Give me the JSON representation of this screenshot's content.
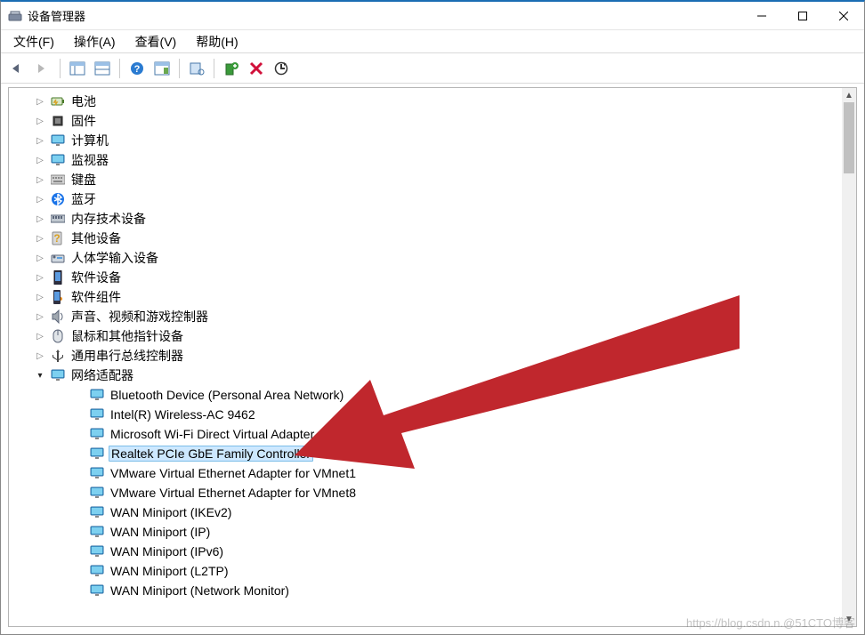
{
  "window": {
    "title": "设备管理器"
  },
  "menu": {
    "file": "文件(F)",
    "action": "操作(A)",
    "view": "查看(V)",
    "help": "帮助(H)"
  },
  "toolbar": {
    "back": "back",
    "forward": "forward",
    "grid1": "view-panel",
    "grid2": "view-list",
    "help": "help",
    "grid3": "view-details",
    "scan1": "scan-hardware",
    "scan2": "add-hardware",
    "delete": "uninstall",
    "refresh": "refresh"
  },
  "tree": {
    "top": [
      {
        "label": "电池",
        "icon": "battery"
      },
      {
        "label": "固件",
        "icon": "chip"
      },
      {
        "label": "计算机",
        "icon": "monitor"
      },
      {
        "label": "监视器",
        "icon": "monitor"
      },
      {
        "label": "键盘",
        "icon": "keyboard"
      },
      {
        "label": "蓝牙",
        "icon": "bluetooth"
      },
      {
        "label": "内存技术设备",
        "icon": "memory"
      },
      {
        "label": "其他设备",
        "icon": "question"
      },
      {
        "label": "人体学输入设备",
        "icon": "hid"
      },
      {
        "label": "软件设备",
        "icon": "phone"
      },
      {
        "label": "软件组件",
        "icon": "puzzle"
      },
      {
        "label": "声音、视频和游戏控制器",
        "icon": "speaker"
      },
      {
        "label": "鼠标和其他指针设备",
        "icon": "mouse"
      },
      {
        "label": "通用串行总线控制器",
        "icon": "usb"
      }
    ],
    "network": {
      "label": "网络适配器",
      "icon": "monitor",
      "children": [
        {
          "label": "Bluetooth Device (Personal Area Network)"
        },
        {
          "label": "Intel(R) Wireless-AC 9462"
        },
        {
          "label": "Microsoft Wi-Fi Direct Virtual Adapter"
        },
        {
          "label": "Realtek PCIe GbE Family Controller",
          "selected": true
        },
        {
          "label": "VMware Virtual Ethernet Adapter for VMnet1"
        },
        {
          "label": "VMware Virtual Ethernet Adapter for VMnet8"
        },
        {
          "label": "WAN Miniport (IKEv2)"
        },
        {
          "label": "WAN Miniport (IP)"
        },
        {
          "label": "WAN Miniport (IPv6)"
        },
        {
          "label": "WAN Miniport (L2TP)"
        },
        {
          "label": "WAN Miniport (Network Monitor)"
        }
      ]
    }
  },
  "watermark": "https://blog.csdn.n.@51CTO博客"
}
